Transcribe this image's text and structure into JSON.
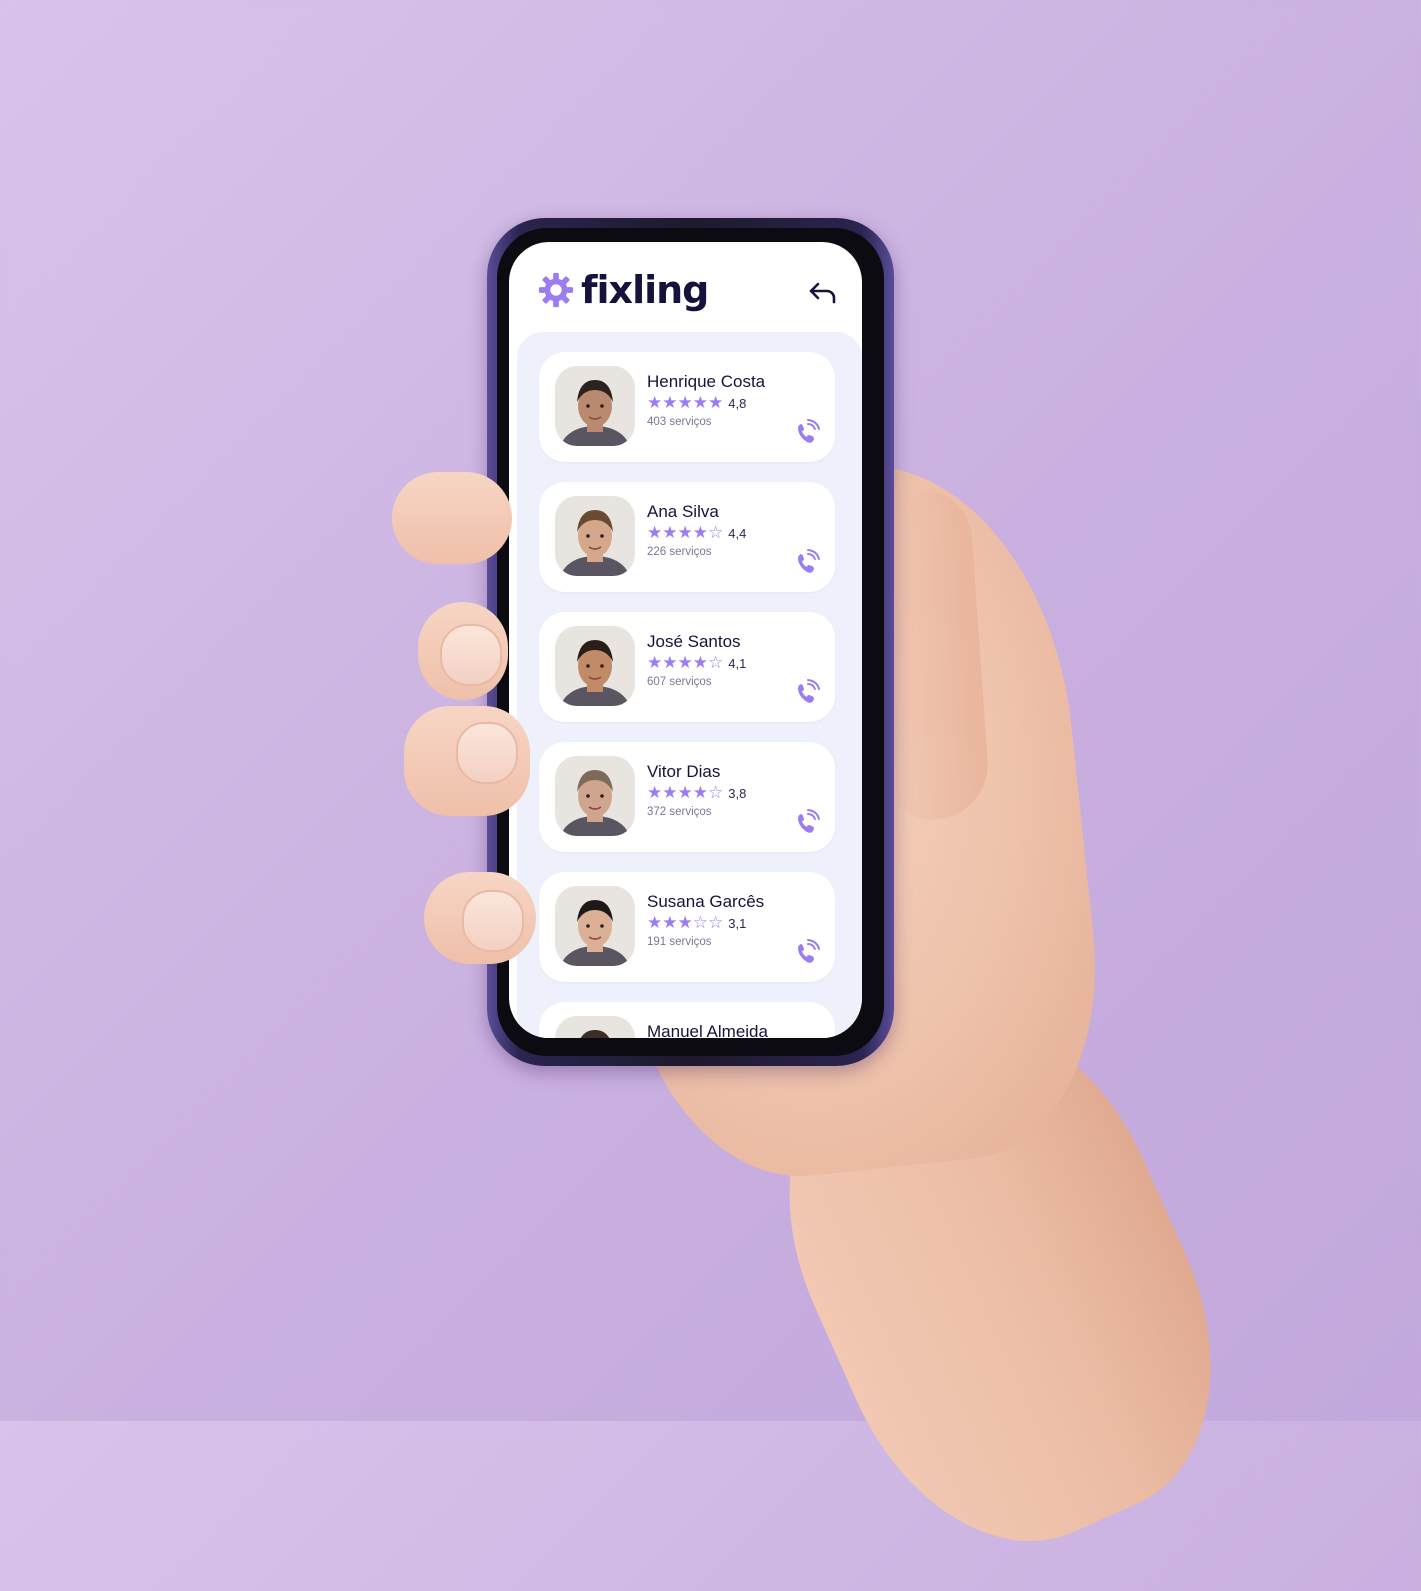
{
  "app": {
    "name": "fixling",
    "accent_color": "#9c7cf1",
    "brand_text_color": "#15123b"
  },
  "header": {
    "logo_icon": "gear-icon",
    "back_icon": "back-arrow-icon"
  },
  "workers": [
    {
      "name": "Henrique Costa",
      "stars": 5,
      "rating": "4,8",
      "services": "403 serviços",
      "avatar": "person-photo"
    },
    {
      "name": "Ana Silva",
      "stars": 4,
      "rating": "4,4",
      "services": "226 serviços",
      "avatar": "person-photo"
    },
    {
      "name": "José Santos",
      "stars": 4,
      "rating": "4,1",
      "services": "607 serviços",
      "avatar": "person-photo"
    },
    {
      "name": "Vitor Dias",
      "stars": 4,
      "rating": "3,8",
      "services": "372 serviços",
      "avatar": "person-photo"
    },
    {
      "name": "Susana Garcês",
      "stars": 3,
      "rating": "3,1",
      "services": "191 serviços",
      "avatar": "person-photo"
    },
    {
      "name": "Manuel Almeida",
      "avatar": "person-photo"
    }
  ]
}
